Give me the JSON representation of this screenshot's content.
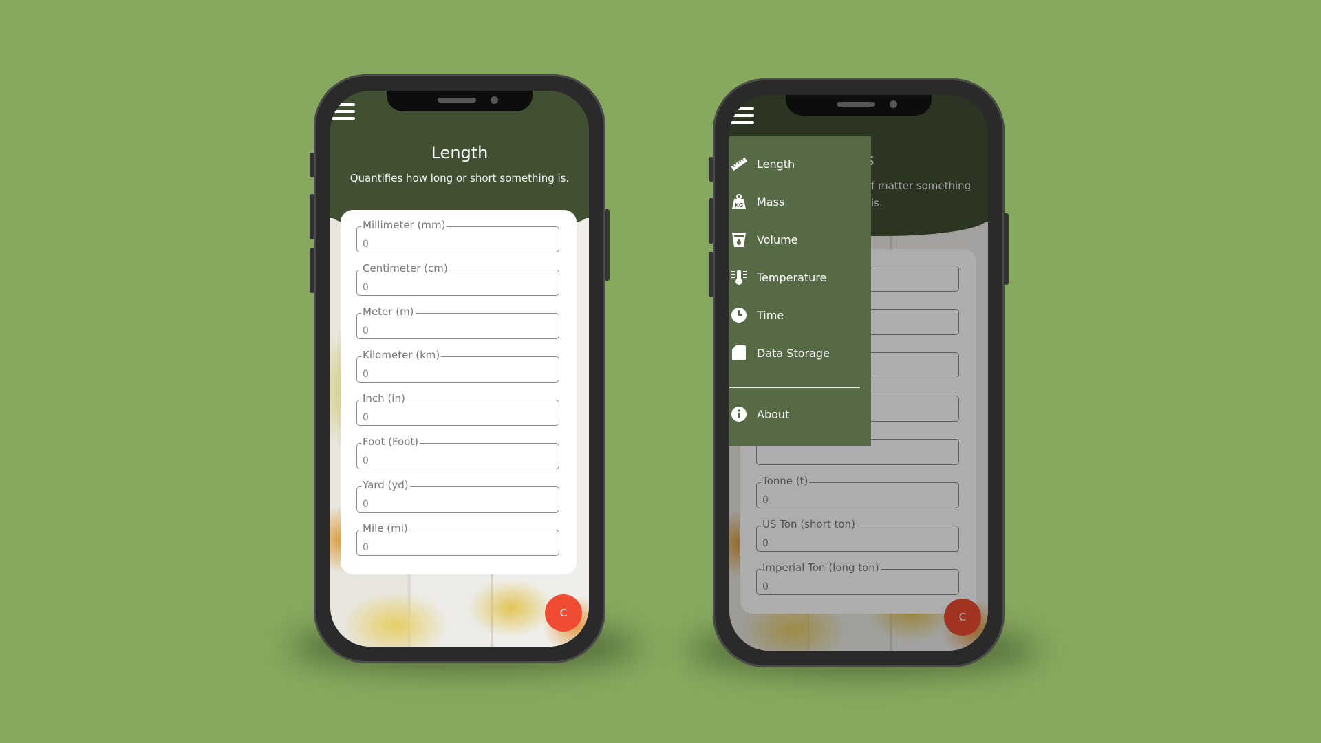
{
  "colors": {
    "background": "#87a85f",
    "header": "#414f32",
    "drawer": "#566a46",
    "fab": "#ef4c33"
  },
  "phone_left": {
    "title": "Length",
    "subtitle": "Quantifies how long or short something is.",
    "fields": [
      {
        "label": "Millimeter (mm)",
        "value": "0"
      },
      {
        "label": "Centimeter (cm)",
        "value": "0"
      },
      {
        "label": "Meter (m)",
        "value": "0"
      },
      {
        "label": "Kilometer (km)",
        "value": "0"
      },
      {
        "label": "Inch (in)",
        "value": "0"
      },
      {
        "label": "Foot (Foot)",
        "value": "0"
      },
      {
        "label": "Yard (yd)",
        "value": "0"
      },
      {
        "label": "Mile (mi)",
        "value": "0"
      }
    ],
    "fab_label": "C"
  },
  "phone_right": {
    "title_fragment": "s",
    "subtitle_fragment_1": "f matter something",
    "subtitle_fragment_2": "is.",
    "menu": [
      {
        "label": "Length",
        "icon": "ruler-icon"
      },
      {
        "label": "Mass",
        "icon": "weight-kg-icon"
      },
      {
        "label": "Volume",
        "icon": "beaker-icon"
      },
      {
        "label": "Temperature",
        "icon": "thermometer-icon"
      },
      {
        "label": "Time",
        "icon": "clock-icon"
      },
      {
        "label": "Data Storage",
        "icon": "sd-card-icon"
      }
    ],
    "about_label": "About",
    "about_icon": "info-icon",
    "fields": [
      {
        "label": "Tonne (t)",
        "value": "0"
      },
      {
        "label": "US Ton (short ton)",
        "value": "0"
      },
      {
        "label": "Imperial Ton (long ton)",
        "value": "0"
      }
    ],
    "fab_label": "C"
  }
}
